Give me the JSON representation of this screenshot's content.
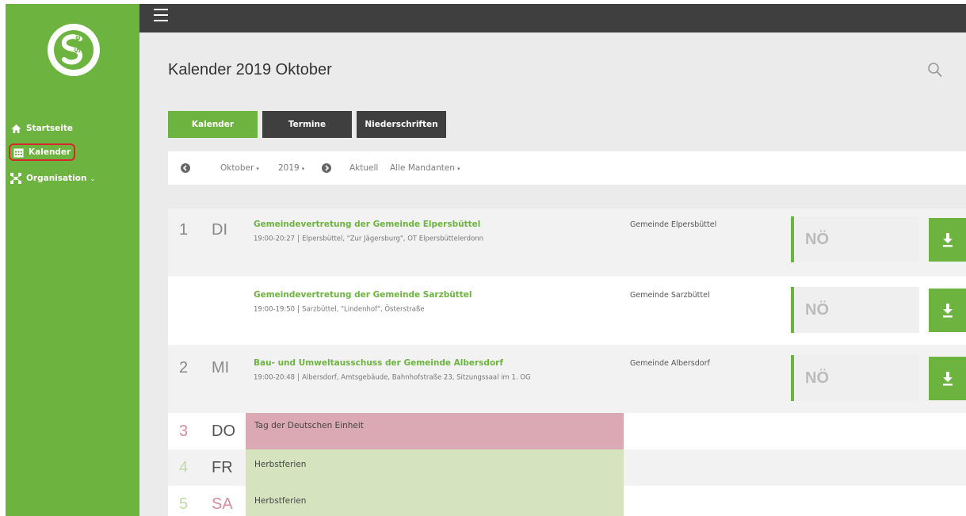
{
  "sidebar": {
    "logo_text": "SNet",
    "items": [
      {
        "label": "Startseite",
        "icon": "home-icon"
      },
      {
        "label": "Kalender",
        "icon": "calendar-icon",
        "active": true
      },
      {
        "label": "Organisation",
        "icon": "organisation-icon",
        "has_dropdown": true
      }
    ]
  },
  "header": {
    "title": "Kalender 2019 Oktober"
  },
  "tabs": [
    {
      "label": "Kalender",
      "active": true
    },
    {
      "label": "Termine"
    },
    {
      "label": "Niederschriften"
    }
  ],
  "filters": {
    "month": "Oktober",
    "year": "2019",
    "today": "Aktuell",
    "clients": "Alle Mandanten"
  },
  "events": [
    {
      "day_number": "1",
      "day_name": "DI",
      "title": "Gemeindevertretung der Gemeinde Elpersbüttel",
      "time": "19:00-20:27",
      "location": "Elpersbüttel, \"Zur Jägersburg\", OT Elpersbüttelerdonn",
      "organisation": "Gemeinde Elpersbüttel",
      "status": "NÖ"
    },
    {
      "day_number": "",
      "day_name": "",
      "title": "Gemeindevertretung der Gemeinde Sarzbüttel",
      "time": "19:00-19:50",
      "location": "Sarzbüttel, \"Lindenhof\", Österstraße",
      "organisation": "Gemeinde Sarzbüttel",
      "status": "NÖ"
    },
    {
      "day_number": "2",
      "day_name": "MI",
      "title": "Bau- und Umweltausschuss der Gemeinde Albersdorf",
      "time": "19:00-20:48",
      "location": "Albersdorf, Amtsgebäude, Bahnhofstraße 23, Sitzungssaal im 1. OG",
      "organisation": "Gemeinde Albersdorf",
      "status": "NÖ"
    }
  ],
  "holidays": [
    {
      "day_number": "3",
      "day_name": "DO",
      "label": "Tag der Deutschen Einheit",
      "kind": "holiday"
    },
    {
      "day_number": "4",
      "day_name": "FR",
      "label": "Herbstferien",
      "kind": "vacation"
    },
    {
      "day_number": "5",
      "day_name": "SA",
      "label": "Herbstferien",
      "kind": "vacation"
    }
  ],
  "colors": {
    "brand_green": "#6db33f",
    "dark_bar": "#3f3f3f",
    "holiday_red": "#dba9b3",
    "vacation_green": "#d5e4bf",
    "active_outline": "#d9262a"
  }
}
